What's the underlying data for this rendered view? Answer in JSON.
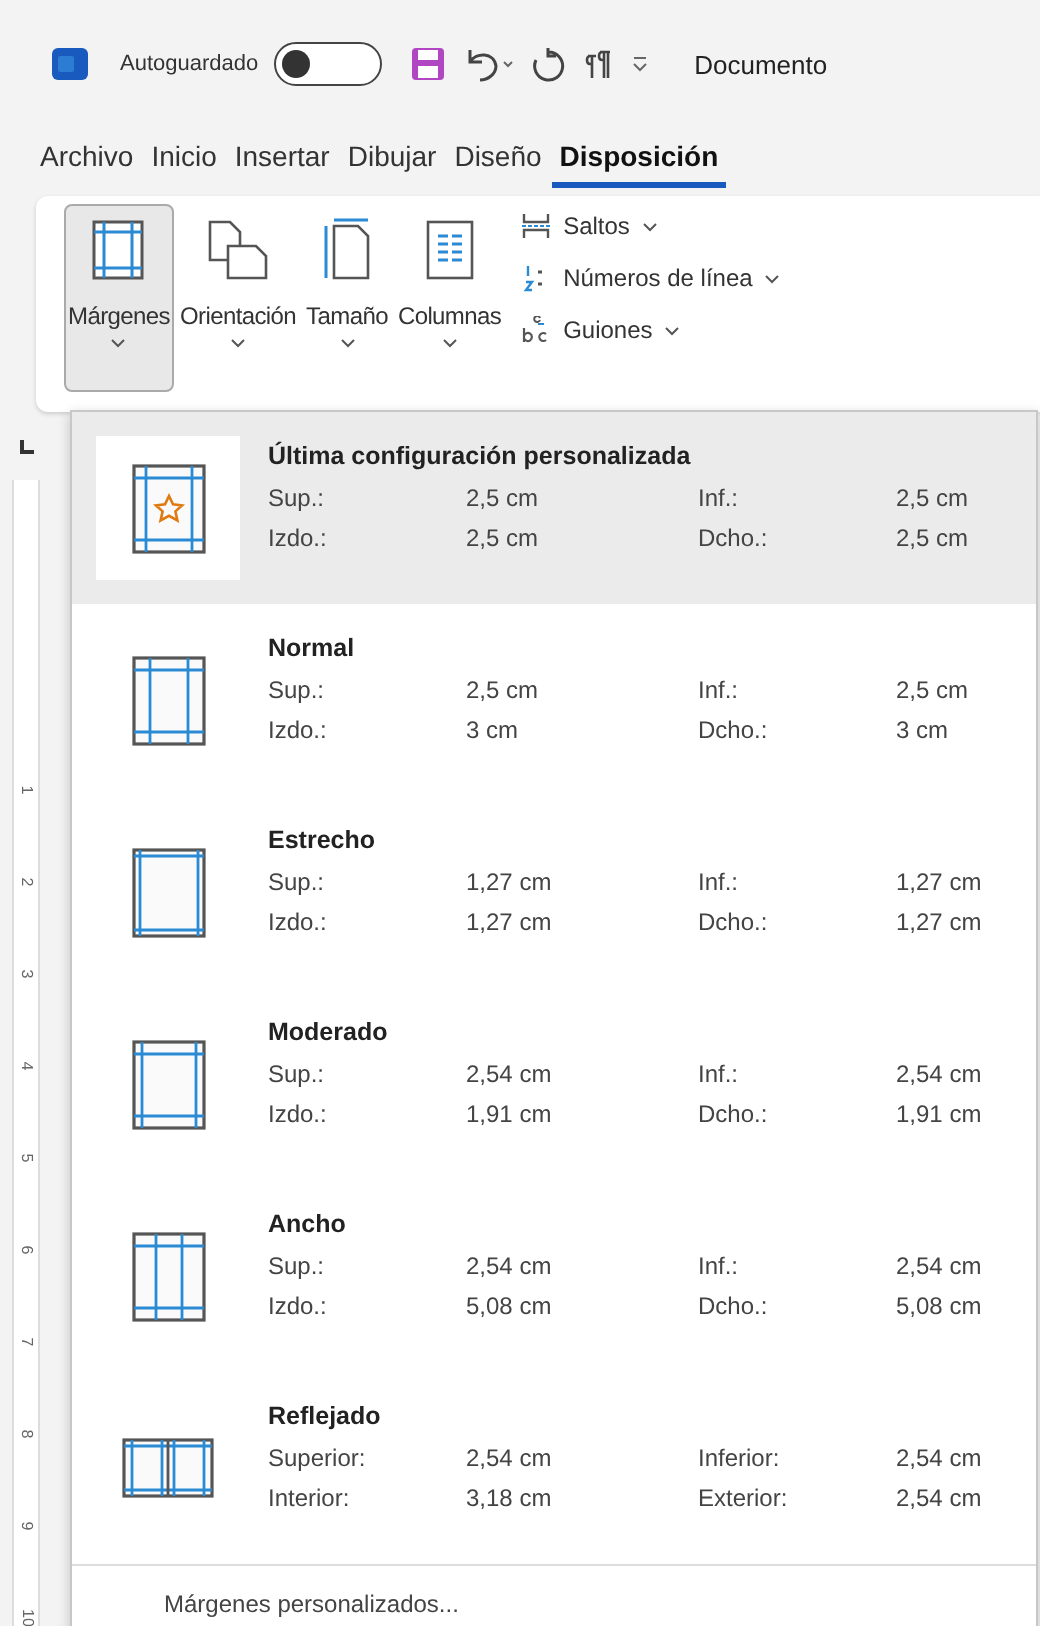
{
  "title_bar": {
    "autosave_label": "Autoguardado",
    "autosave_on": false,
    "document_title": "Documento"
  },
  "tabs": [
    {
      "label": "Archivo",
      "selected": false
    },
    {
      "label": "Inicio",
      "selected": false
    },
    {
      "label": "Insertar",
      "selected": false
    },
    {
      "label": "Dibujar",
      "selected": false
    },
    {
      "label": "Diseño",
      "selected": false
    },
    {
      "label": "Disposición",
      "selected": true
    }
  ],
  "ribbon": {
    "big_buttons": [
      {
        "label": "Márgenes",
        "kind": "margins",
        "selected": true
      },
      {
        "label": "Orientación",
        "kind": "orientation",
        "selected": false
      },
      {
        "label": "Tamaño",
        "kind": "size",
        "selected": false
      },
      {
        "label": "Columnas",
        "kind": "columns",
        "selected": false
      }
    ],
    "small_buttons": [
      {
        "label": "Saltos",
        "kind": "breaks"
      },
      {
        "label": "Números de línea",
        "kind": "line_numbers"
      },
      {
        "label": "Guiones",
        "kind": "hyphenation"
      }
    ]
  },
  "ruler": {
    "numbers": [
      "1",
      "2",
      "3",
      "4",
      "5",
      "6",
      "7",
      "8",
      "9",
      "10"
    ]
  },
  "margins_menu": {
    "items": [
      {
        "name": "Última configuración personalizada",
        "kind": "custom",
        "selected": true,
        "rows": [
          [
            "Sup.:",
            "2,5 cm",
            "Inf.:",
            "2,5 cm"
          ],
          [
            "Izdo.:",
            "2,5 cm",
            "Dcho.:",
            "2,5 cm"
          ]
        ]
      },
      {
        "name": "Normal",
        "kind": "normal",
        "selected": false,
        "rows": [
          [
            "Sup.:",
            "2,5 cm",
            "Inf.:",
            "2,5 cm"
          ],
          [
            "Izdo.:",
            "3 cm",
            "Dcho.:",
            "3 cm"
          ]
        ]
      },
      {
        "name": "Estrecho",
        "kind": "narrow",
        "selected": false,
        "rows": [
          [
            "Sup.:",
            "1,27 cm",
            "Inf.:",
            "1,27 cm"
          ],
          [
            "Izdo.:",
            "1,27 cm",
            "Dcho.:",
            "1,27 cm"
          ]
        ]
      },
      {
        "name": "Moderado",
        "kind": "moderate",
        "selected": false,
        "rows": [
          [
            "Sup.:",
            "2,54 cm",
            "Inf.:",
            "2,54 cm"
          ],
          [
            "Izdo.:",
            "1,91 cm",
            "Dcho.:",
            "1,91 cm"
          ]
        ]
      },
      {
        "name": "Ancho",
        "kind": "wide",
        "selected": false,
        "rows": [
          [
            "Sup.:",
            "2,54 cm",
            "Inf.:",
            "2,54 cm"
          ],
          [
            "Izdo.:",
            "5,08 cm",
            "Dcho.:",
            "5,08 cm"
          ]
        ]
      },
      {
        "name": "Reflejado",
        "kind": "mirrored",
        "selected": false,
        "rows": [
          [
            "Superior:",
            "2,54 cm",
            "Inferior:",
            "2,54 cm"
          ],
          [
            "Interior:",
            "3,18 cm",
            "Exterior:",
            "2,54 cm"
          ]
        ]
      }
    ],
    "footer": "Márgenes personalizados..."
  }
}
